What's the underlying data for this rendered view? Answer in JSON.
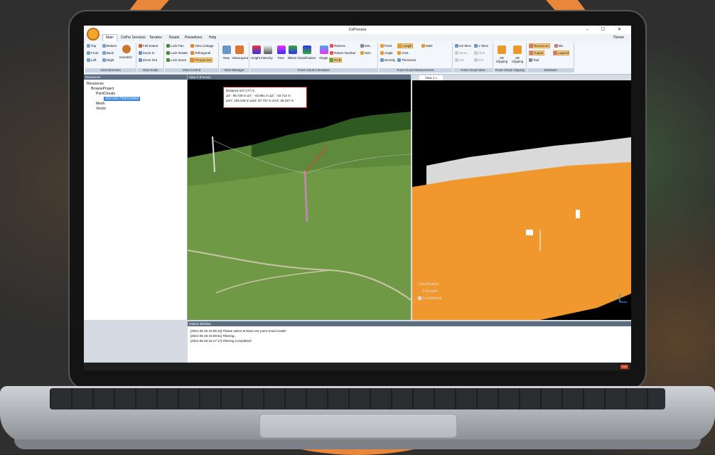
{
  "app": {
    "title": "CoProcess",
    "theme_label": "Theme"
  },
  "window_controls": "–  ☐  ✕",
  "tabs": [
    "Main",
    "CoPro Services",
    "Terrains",
    "Roads",
    "Powerlines",
    "Help"
  ],
  "ribbon": {
    "view_direction": {
      "label": "View Direction",
      "buttons": [
        "Top",
        "Bottom",
        "Front",
        "Back",
        "Left",
        "Right",
        "Isometric"
      ]
    },
    "view_scale": {
      "label": "View Scale",
      "buttons": [
        "Full Extent",
        "Zoom In",
        "Zoom Out"
      ]
    },
    "view_control": {
      "label": "View Control",
      "buttons": [
        "Lock Pan",
        "View Linkage",
        "Lock Rotate",
        "Orthogonal",
        "Lock Zoom",
        "Perspective"
      ]
    },
    "view_manager": {
      "label": "View Manager",
      "buttons": [
        "New",
        "ViewLayout"
      ]
    },
    "coloration": {
      "label": "Point Cloud Coloration",
      "buttons": [
        "Height",
        "Intencity",
        "Time",
        "Blend",
        "Classification",
        "Single",
        "Returns",
        "Return Number",
        "RGB",
        "EDL",
        "Size"
      ]
    },
    "measurement": {
      "label": "Point Cloud Measurement",
      "buttons": [
        "Point",
        "Length",
        "Multi",
        "Angle",
        "Area",
        "Density",
        "Thickness"
      ]
    },
    "slice": {
      "label": "Point Cloud Slice",
      "buttons": [
        "HZ Slice",
        "V Slice",
        "Show",
        "Hide",
        "Set",
        "Exit"
      ]
    },
    "clipping": {
      "label": "Point Cloud Clipping",
      "buttons": [
        "2D Clipping",
        "3D Clipping"
      ]
    },
    "windows": {
      "label": "Windows",
      "buttons": [
        "Resources",
        "Bin",
        "Output",
        "Legend",
        "Tool"
      ]
    }
  },
  "resources": {
    "header": "Resources",
    "tree": [
      "Resources",
      "BrowseProject",
      "PointClouds",
      "20210617095524060",
      "Mesh",
      "Vector"
    ]
  },
  "view2": {
    "header": "View 2 (Focus)"
  },
  "view1": {
    "tab": "View 1",
    "close": "x"
  },
  "measurement": {
    "distance": "Distance:107.177 m",
    "line1": "ΔX : 95.729 m  ΔY : -43.981 m  ΔZ : -19.712 m",
    "line2": "ΔXY: 105.349 m  ΔXZ: 97.737 m  ΔYZ: 48.197 m"
  },
  "legend": {
    "title": "Classification",
    "items": [
      "2-Ground",
      "0-Undefined"
    ]
  },
  "output": {
    "header": "Output Window",
    "lines": [
      "[2021-05-25 15:08:16] Please select at least one point cloud model!",
      "[2021-05-25 15:09:51] Filtering...",
      "[2021-05-25 15:17:17] Filtering Completed!"
    ]
  },
  "status_badge": "XXX",
  "colors": {
    "accent": "#e8873a",
    "ground": "#f0982e",
    "selection": "#3a86d8"
  }
}
